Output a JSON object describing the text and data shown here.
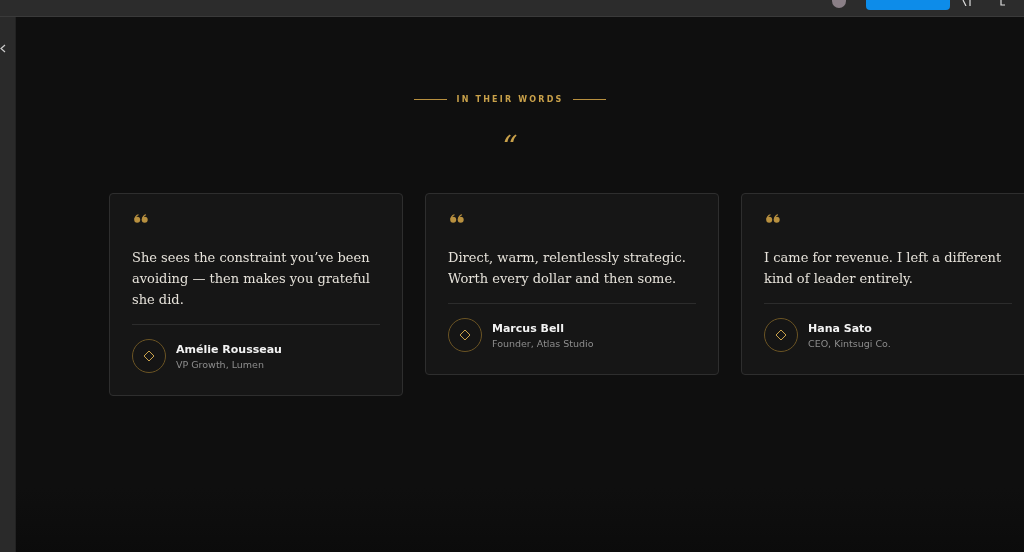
{
  "section": {
    "eyebrow": "IN THEIR WORDS",
    "quote_mark": "“"
  },
  "testimonials": [
    {
      "quote": "She sees the constraint you’ve been avoiding — then makes you grateful she did.",
      "name": "Amélie Rousseau",
      "role": "VP Growth, Lumen"
    },
    {
      "quote": "Direct, warm, relentlessly strategic. Worth every dollar and then some.",
      "name": "Marcus Bell",
      "role": "Founder, Atlas Studio"
    },
    {
      "quote": "I came for revenue. I left a different kind of leader entirely.",
      "name": "Hana Sato",
      "role": "CEO, Kintsugi Co."
    }
  ]
}
